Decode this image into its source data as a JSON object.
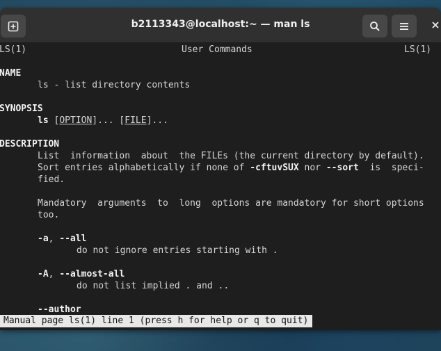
{
  "window": {
    "title": "b2113343@localhost:~ — man ls"
  },
  "icons": {
    "new_tab": "new-tab-icon",
    "search": "search-icon",
    "menu": "hamburger-menu-icon",
    "close": "close-icon"
  },
  "man": {
    "header_left": "LS(1)",
    "header_center": "User Commands",
    "header_right": "LS(1)",
    "name_heading": "NAME",
    "name_line": "ls - list directory contents",
    "synopsis_heading": "SYNOPSIS",
    "synopsis_cmd": "ls",
    "synopsis_sp1": " [",
    "synopsis_option": "OPTION",
    "synopsis_mid": "]... [",
    "synopsis_file": "FILE",
    "synopsis_end": "]...",
    "description_heading": "DESCRIPTION",
    "desc_line1": "List  information  about  the FILEs (the current directory by default).",
    "desc_line2_a": "Sort entries alphabetically if none of ",
    "desc_line2_flags": "-cftuvSUX",
    "desc_line2_b": " nor ",
    "desc_line2_sort": "--sort",
    "desc_line2_c": "  is  speci-",
    "desc_line3": "fied.",
    "mand_line1": "Mandatory  arguments  to  long  options are mandatory for short options",
    "mand_line2": "too.",
    "opt_a_short": "-a",
    "opt_a_sep": ", ",
    "opt_a_long": "--all",
    "opt_a_desc": "do not ignore entries starting with .",
    "opt_A_short": "-A",
    "opt_A_sep": ", ",
    "opt_A_long": "--almost-all",
    "opt_A_desc": "do not list implied . and ..",
    "opt_author": "--author"
  },
  "status_bar": {
    "text": "Manual page ls(1) line 1 (press h for help or q to quit)"
  }
}
